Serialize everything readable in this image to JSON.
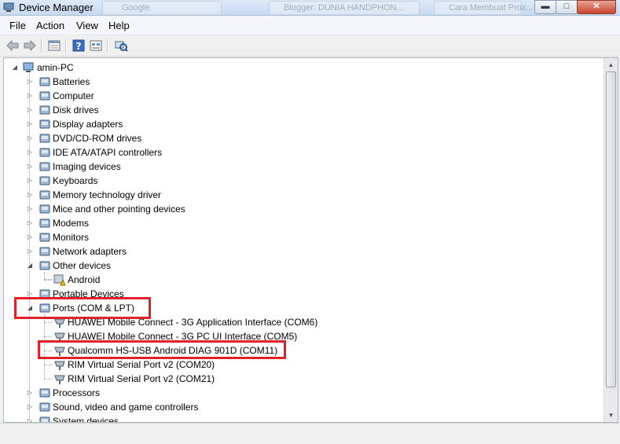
{
  "window": {
    "title": "Device Manager",
    "background_tabs": [
      "Google",
      "Blogger: DUNIA HANDPHON...",
      "Cara Membuat Prox..."
    ],
    "controls": {
      "minimize": "▬",
      "maximize": "□",
      "close": "✕"
    }
  },
  "menu": {
    "items": [
      "File",
      "Action",
      "View",
      "Help"
    ]
  },
  "toolbar": {
    "buttons": [
      "back-arrow-icon",
      "forward-arrow-icon",
      "properties-icon",
      "help-icon",
      "details-icon",
      "scan-hardware-icon"
    ]
  },
  "tree": {
    "root": "amin-PC",
    "categories": [
      "Batteries",
      "Computer",
      "Disk drives",
      "Display adapters",
      "DVD/CD-ROM drives",
      "IDE ATA/ATAPI controllers",
      "Imaging devices",
      "Keyboards",
      "Memory technology driver",
      "Mice and other pointing devices",
      "Modems",
      "Monitors",
      "Network adapters",
      "Other devices",
      "Portable Devices",
      "Ports (COM & LPT)",
      "Processors",
      "Sound, video and game controllers",
      "System devices"
    ],
    "other_devices_children": [
      "Android"
    ],
    "ports_children": [
      "HUAWEI Mobile Connect - 3G Application Interface (COM6)",
      "HUAWEI Mobile Connect - 3G PC UI Interface (COM5)",
      "Qualcomm HS-USB Android DIAG 901D (COM11)",
      "RIM Virtual Serial Port v2 (COM20)",
      "RIM Virtual Serial Port v2 (COM21)"
    ]
  },
  "annotations": {
    "color": "#e3202a"
  }
}
